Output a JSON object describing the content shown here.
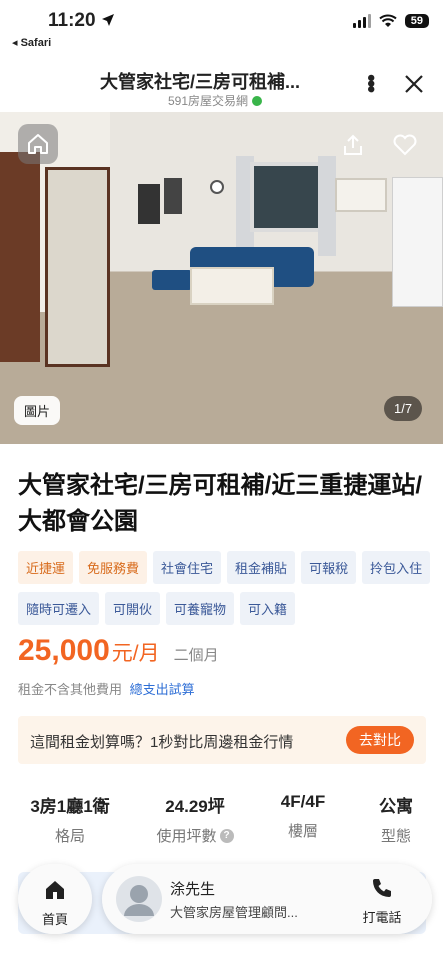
{
  "status_bar": {
    "time": "11:20",
    "back_label": "◂ Safari",
    "battery": "59"
  },
  "nav": {
    "title": "大管家社宅/三房可租補...",
    "subtitle": "591房屋交易網",
    "more_icon": "more-vertical-icon",
    "close_icon": "close-icon"
  },
  "photo": {
    "tag": "圖片",
    "counter": "1/7"
  },
  "listing": {
    "title": "大管家社宅/三房可租補/近三重捷運站/大都會公園",
    "tags": [
      {
        "label": "近捷運",
        "style": "warm"
      },
      {
        "label": "免服務費",
        "style": "warm"
      },
      {
        "label": "社會住宅",
        "style": "cool"
      },
      {
        "label": "租金補貼",
        "style": "cool"
      },
      {
        "label": "可報稅",
        "style": "cool"
      },
      {
        "label": "拎包入住",
        "style": "cool"
      },
      {
        "label": "隨時可遷入",
        "style": "cool"
      },
      {
        "label": "可開伙",
        "style": "cool"
      },
      {
        "label": "可養寵物",
        "style": "cool"
      },
      {
        "label": "可入籍",
        "style": "cool"
      }
    ],
    "price": "25,000",
    "price_unit": "元/月",
    "deposit_term": "二個月",
    "price_note": "租金不含其他費用",
    "price_link": "總支出試算"
  },
  "compare": {
    "text": "這間租金划算嗎？1秒對比周邊租金行情",
    "button": "去對比"
  },
  "specs": [
    {
      "value": "3房1廳1衛",
      "label": "格局"
    },
    {
      "value": "24.29坪",
      "label": "使用坪數",
      "help": "?"
    },
    {
      "value": "4F/4F",
      "label": "樓層"
    },
    {
      "value": "公寓",
      "label": "型態"
    }
  ],
  "bottom": {
    "home_label": "首頁",
    "agent_name": "涂先生",
    "agent_role": "大管家房屋管理顧問...",
    "call_label": "打電話"
  },
  "colors": {
    "accent": "#f26522",
    "link": "#2f6fd6",
    "tag_cool_bg": "#eef2f8",
    "tag_warm_bg": "#fdf1e6"
  }
}
